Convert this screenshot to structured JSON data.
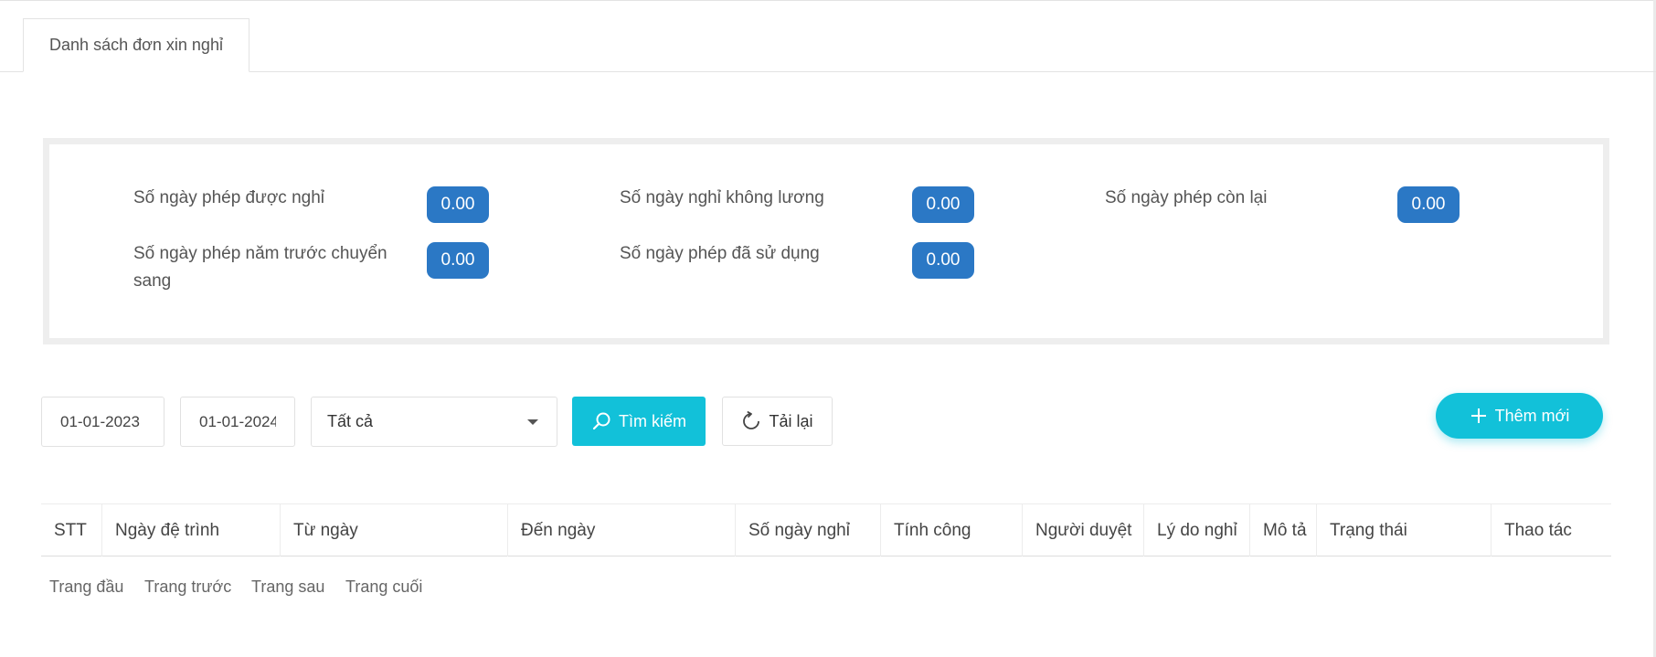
{
  "tab": {
    "label": "Danh sách đơn xin nghỉ"
  },
  "summary": {
    "annual_allowed": {
      "label": "Số ngày phép được nghỉ",
      "value": "0.00"
    },
    "unpaid": {
      "label": "Số ngày nghỉ không lương",
      "value": "0.00"
    },
    "remaining": {
      "label": "Số ngày phép còn lại",
      "value": "0.00"
    },
    "carried_over": {
      "label": "Số ngày phép năm trước chuyển sang",
      "value": "0.00"
    },
    "used": {
      "label": "Số ngày phép đã sử dụng",
      "value": "0.00"
    }
  },
  "toolbar": {
    "from_date": "01-01-2023",
    "to_date": "01-01-2024",
    "status_select": "Tất cả",
    "search_label": "Tìm kiếm",
    "reload_label": "Tải lại",
    "add_label": "Thêm mới"
  },
  "table": {
    "columns": [
      "STT",
      "Ngày đệ trình",
      "Từ ngày",
      "Đến ngày",
      "Số ngày nghỉ",
      "Tính công",
      "Người duyệt",
      "Lý do nghỉ",
      "Mô tả",
      "Trạng thái",
      "Thao tác"
    ]
  },
  "pagination": {
    "first": "Trang đầu",
    "prev": "Trang trước",
    "next": "Trang sau",
    "last": "Trang cuối"
  },
  "colors": {
    "badge": "#2b78c5",
    "primary": "#12c1d9"
  }
}
